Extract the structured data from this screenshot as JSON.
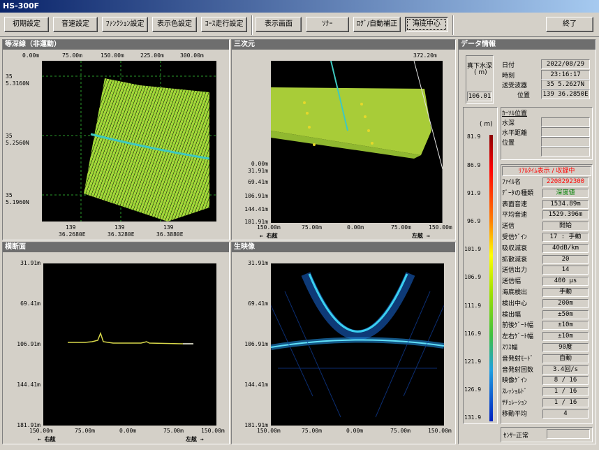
{
  "app": {
    "title": "HS-300F"
  },
  "toolbar": {
    "buttons": [
      "初期設定",
      "音速設定",
      "ﾌｧﾝｸｼｮﾝ設定",
      "表示色設定",
      "ｺｰｽ走行設定",
      "表示画面",
      "ｿﾅｰ",
      "ﾛｸﾞ/自動補正",
      "海底中心",
      "終了"
    ]
  },
  "contour": {
    "title": "等深線（非運動）",
    "top_ticks": [
      "0.00m",
      "75.00m",
      "150.00m",
      "225.00m",
      "300.00m"
    ],
    "y_labels": [
      [
        "35",
        "5.3160N"
      ],
      [
        "35",
        "5.2560N"
      ],
      [
        "35",
        "5.1960N"
      ]
    ],
    "x_labels": [
      [
        "139",
        "36.2680E"
      ],
      [
        "139",
        "36.3280E"
      ],
      [
        "139",
        "36.3880E"
      ]
    ]
  },
  "three_d": {
    "title": "三次元",
    "top_right": "372.20m",
    "y_ticks": [
      "0.00m",
      "31.91m",
      "69.41m",
      "106.91m",
      "144.41m",
      "181.91m"
    ],
    "x_ticks": [
      "150.00m",
      "75.00m",
      "0.00m",
      "75.00m",
      "150.00m"
    ],
    "left_dir": "←  右舷",
    "right_dir": "左舷  →"
  },
  "cross": {
    "title": "横断面",
    "y_ticks": [
      "31.91m",
      "69.41m",
      "106.91m",
      "144.41m",
      "181.91m"
    ],
    "x_ticks": [
      "150.00m",
      "75.00m",
      "0.00m",
      "75.00m",
      "150.00m"
    ],
    "left_dir": "←  右舷",
    "right_dir": "左舷  →"
  },
  "raw": {
    "title": "生映像",
    "y_ticks": [
      "31.91m",
      "69.41m",
      "106.91m",
      "144.41m",
      "181.91m"
    ],
    "x_ticks": [
      "150.00m",
      "75.00m",
      "0.00m",
      "75.00m",
      "150.00m"
    ]
  },
  "data_info": {
    "title": "データ情報",
    "depth_label": "真下水深",
    "depth_unit": "( m)",
    "depth_value": "106.01",
    "date_label": "日付",
    "date": "2022/08/29",
    "time_label": "時刻",
    "time": "23:16:17",
    "tx_label": "送受波器",
    "tx_lat": "35 5.2627N",
    "pos_label": "位置",
    "tx_lon": "139 36.2850E",
    "scale_unit": "( m)",
    "scale": [
      "81.9",
      "86.9",
      "91.9",
      "96.9",
      "101.9",
      "106.9",
      "111.9",
      "116.9",
      "121.9",
      "126.9",
      "131.9"
    ],
    "cursor_title": "ｶｰｿﾙ位置",
    "cursor_rows": [
      "水深",
      "水平距離",
      "位置"
    ],
    "status_header": "ﾘｱﾙﾀｲﾑ表示 / 収録中",
    "rows": [
      [
        "ﾌｧｲﾙ名",
        "2208292300"
      ],
      [
        "ﾃﾞｰﾀの種類",
        "深度値"
      ],
      [
        "表面音速",
        "1534.89m"
      ],
      [
        "平均音速",
        "1529.396m"
      ],
      [
        "送信",
        "開始"
      ],
      [
        "受信ｹﾞｲﾝ",
        "17 : 手動"
      ],
      [
        "吸収減衰",
        "40dB/km"
      ],
      [
        "拡散減衰",
        "20"
      ],
      [
        "送信出力",
        "14"
      ],
      [
        "送信幅",
        "400 μs"
      ],
      [
        "海底検出",
        "手動"
      ],
      [
        "検出中心",
        "200m"
      ],
      [
        "検出幅",
        "±50m"
      ],
      [
        "前後ｹﾞｰﾄ幅",
        "±10m"
      ],
      [
        "左右ｹﾞｰﾄ幅",
        "±10m"
      ],
      [
        "ｽﾜｽ幅",
        "90度"
      ],
      [
        "音発射ﾓｰﾄﾞ",
        "自動"
      ],
      [
        "音発射回数",
        "3.4回/s"
      ],
      [
        "映像ｹﾞｲﾝ",
        "8 / 16"
      ],
      [
        "ｽﾚｯｼｮﾙﾄﾞ",
        "1 / 16"
      ],
      [
        "ｻﾁｭﾚｰｼｮﾝ",
        "1 / 16"
      ],
      [
        "移動平均",
        "4"
      ]
    ],
    "sensor": "ｾﾝｻｰ正常"
  },
  "colors": {
    "file_name": "#ff0000",
    "data_type": "#008000",
    "status_header": "#ff0000"
  }
}
